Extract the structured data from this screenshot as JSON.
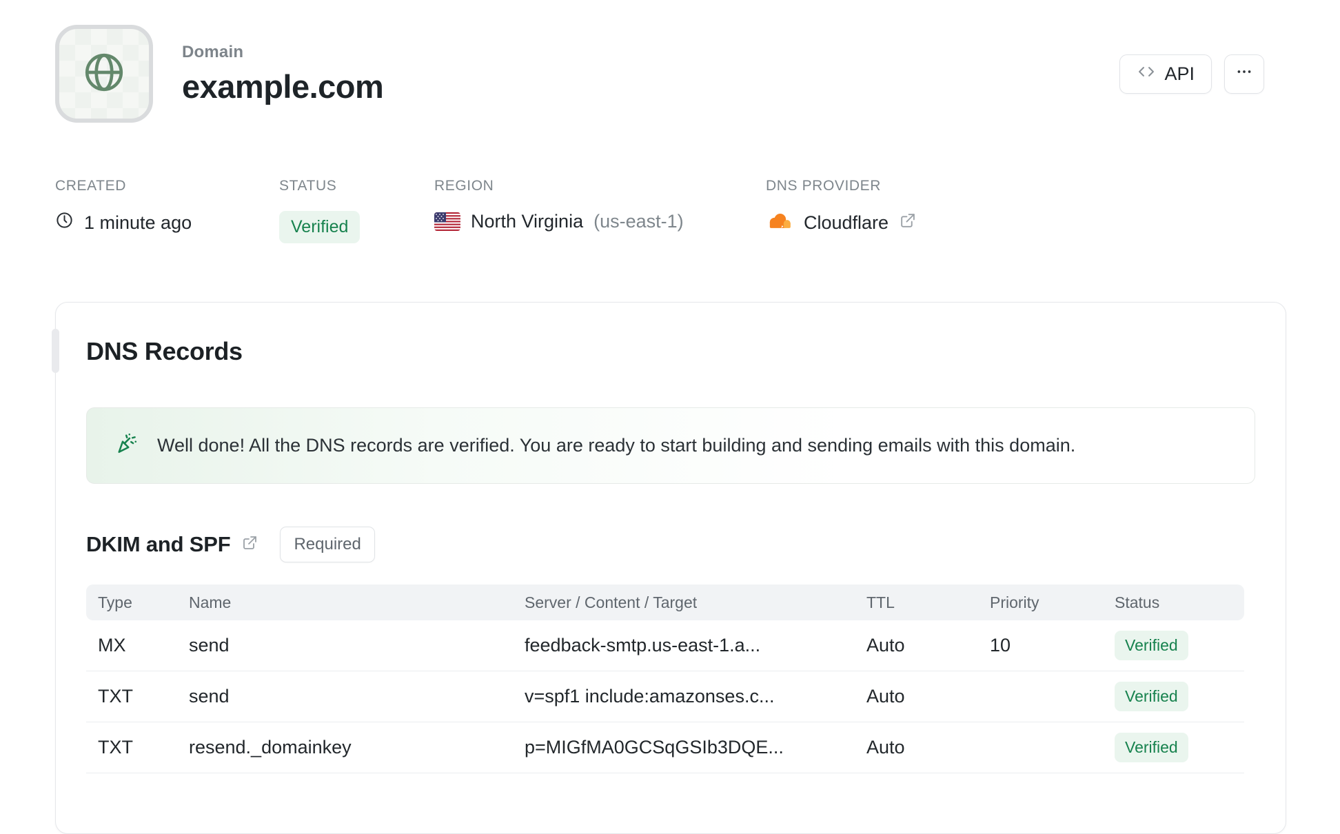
{
  "header": {
    "eyebrow": "Domain",
    "title": "example.com",
    "api_button_label": "API"
  },
  "meta": {
    "created": {
      "label": "CREATED",
      "value": "1 minute ago"
    },
    "status": {
      "label": "STATUS",
      "value": "Verified"
    },
    "region": {
      "label": "REGION",
      "name": "North Virginia",
      "code": "(us-east-1)"
    },
    "dns_provider": {
      "label": "DNS PROVIDER",
      "value": "Cloudflare"
    }
  },
  "dns_records": {
    "title": "DNS Records",
    "banner_text": "Well done! All the DNS records are verified. You are ready to start building and sending emails with this domain.",
    "subsection": {
      "title": "DKIM and SPF",
      "badge": "Required"
    },
    "table": {
      "headers": [
        "Type",
        "Name",
        "Server / Content / Target",
        "TTL",
        "Priority",
        "Status"
      ],
      "rows": [
        {
          "type": "MX",
          "name": "send",
          "content": "feedback-smtp.us-east-1.a...",
          "ttl": "Auto",
          "priority": "10",
          "status": "Verified"
        },
        {
          "type": "TXT",
          "name": "send",
          "content": "v=spf1 include:amazonses.c...",
          "ttl": "Auto",
          "priority": "",
          "status": "Verified"
        },
        {
          "type": "TXT",
          "name": "resend._domainkey",
          "content": "p=MIGfMA0GCSqGSIb3DQE...",
          "ttl": "Auto",
          "priority": "",
          "status": "Verified"
        }
      ]
    }
  },
  "colors": {
    "accent_green": "#17824e",
    "badge_green_bg": "#eaf5ee",
    "cloudflare_orange": "#f6821f",
    "cloudflare_orange_light": "#fbad41"
  }
}
